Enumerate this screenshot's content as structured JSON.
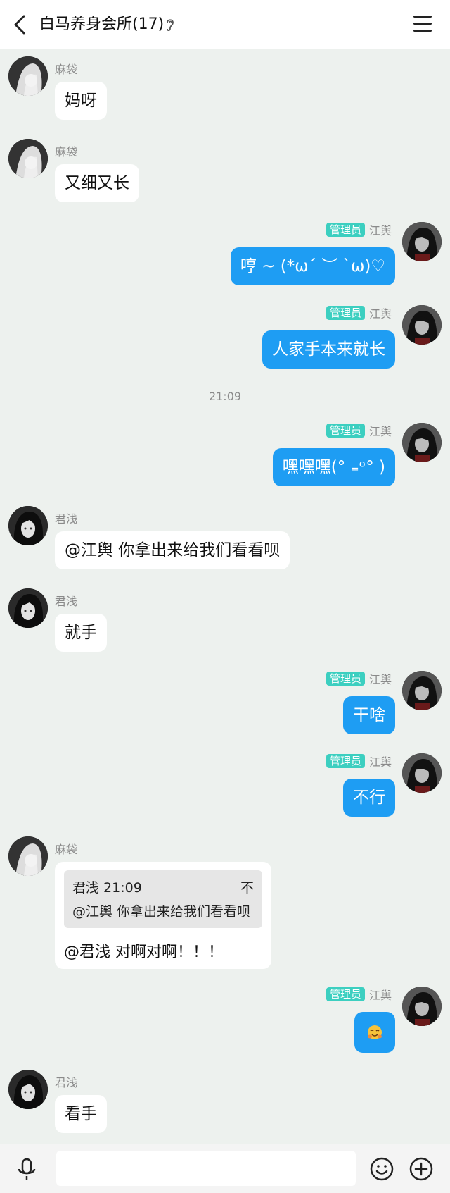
{
  "header": {
    "title": "白马养身会所(17)"
  },
  "messages": [
    {
      "side": "left",
      "name": "麻袋",
      "text": "妈呀",
      "avatar": "avatar-madai"
    },
    {
      "side": "left",
      "name": "麻袋",
      "text": "又细又长",
      "avatar": "avatar-madai"
    },
    {
      "side": "right",
      "badge": "管理员",
      "name": "江舆",
      "text": "哼 ~ (*ω´ ︶ `ω)♡",
      "avatar": "avatar-jiangyu"
    },
    {
      "side": "right",
      "badge": "管理员",
      "name": "江舆",
      "text": "人家手本来就长",
      "avatar": "avatar-jiangyu"
    },
    {
      "time": "21:09"
    },
    {
      "side": "right",
      "badge": "管理员",
      "name": "江舆",
      "text": "嘿嘿嘿(° ₌ᵒ° )",
      "avatar": "avatar-jiangyu"
    },
    {
      "side": "left",
      "name": "君浅",
      "text": "@江舆 你拿出来给我们看看呗",
      "avatar": "avatar-junqian"
    },
    {
      "side": "left",
      "name": "君浅",
      "text": "就手",
      "avatar": "avatar-junqian"
    },
    {
      "side": "right",
      "badge": "管理员",
      "name": "江舆",
      "text": "干啥",
      "avatar": "avatar-jiangyu"
    },
    {
      "side": "right",
      "badge": "管理员",
      "name": "江舆",
      "text": "不行",
      "avatar": "avatar-jiangyu"
    },
    {
      "side": "left",
      "name": "麻袋",
      "avatar": "avatar-madai",
      "quote": {
        "header": "君浅 21:09",
        "pin": "不",
        "text": "@江舆 你拿出来给我们看看呗"
      },
      "text": "@君浅 对啊对啊！！！"
    },
    {
      "side": "right",
      "badge": "管理员",
      "name": "江舆",
      "emoji": "hugging-face-emoji",
      "avatar": "avatar-jiangyu"
    },
    {
      "side": "left",
      "name": "君浅",
      "text": "看手",
      "avatar": "avatar-junqian"
    }
  ],
  "colors": {
    "self_bubble": "#1e9df3",
    "other_bubble": "#ffffff",
    "badge": "#3ccfc0",
    "background": "#edf1ee"
  },
  "icons": [
    "back-arrow-icon",
    "ear-icon",
    "menu-icon",
    "microphone-icon",
    "emoji-icon",
    "plus-icon"
  ]
}
